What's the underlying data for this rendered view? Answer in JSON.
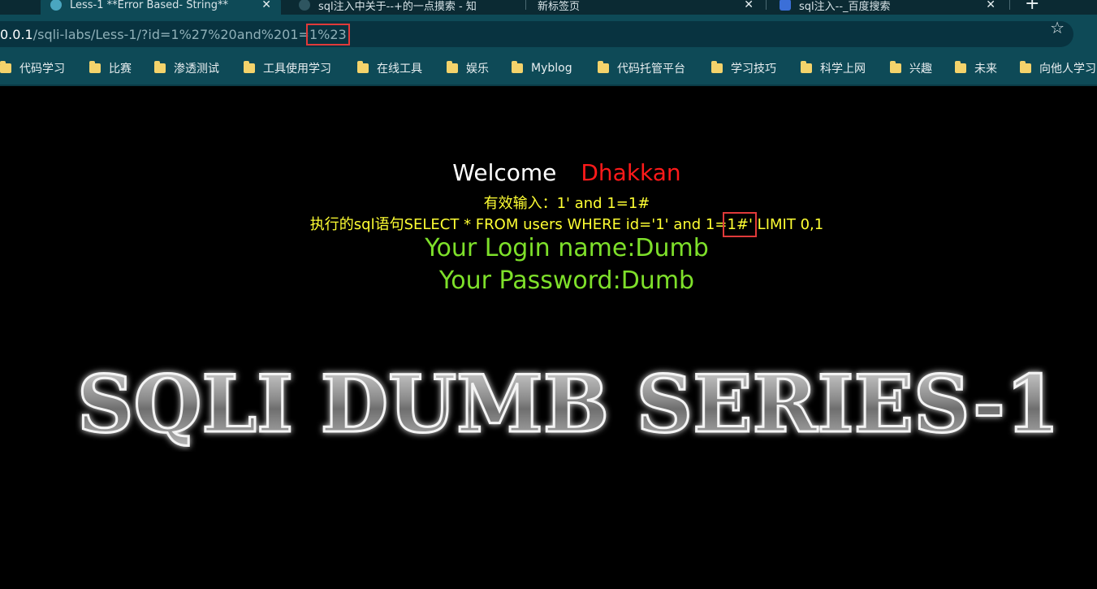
{
  "browser": {
    "tabs": [
      {
        "title": "Less-1 **Error Based- String**",
        "active": true
      },
      {
        "title": "sql注入中关于--+的一点摸索 - 知",
        "active": false
      },
      {
        "title": "新标签页",
        "active": false
      },
      {
        "title": "sql注入--_百度搜索",
        "active": false
      }
    ],
    "close_glyph": "✕",
    "newtab_glyph": "+",
    "url": {
      "host_part": "0.0.1",
      "path_part": "/sqli-labs/Less-1/?id=1%27%20and%201=",
      "highlighted_part": "1%23"
    },
    "star_glyph": "☆",
    "bookmarks": [
      "代码学习",
      "比赛",
      "渗透测试",
      "工具使用学习",
      "在线工具",
      "娱乐",
      "Myblog",
      "代码托管平台",
      "学习技巧",
      "科学上网",
      "兴趣",
      "未来",
      "向他人学习"
    ]
  },
  "page": {
    "welcome_label": "Welcome",
    "welcome_name": "Dhakkan",
    "valid_input": "有效输入：1' and 1=1#",
    "sql_prefix": "执行的sql语句SELECT * FROM users WHERE id='1' and 1=",
    "sql_highlight": "1#'",
    "sql_suffix": " LIMIT 0,1",
    "login_name": "Your Login name:Dumb",
    "password": "Your Password:Dumb",
    "banner_text": "SQLI DUMB SERIES-1"
  },
  "colors": {
    "tab_bar": "#0b2a33",
    "toolbar": "#0e4a57",
    "highlight_box": "#e03a3a",
    "welcome_name": "#ff1a1a",
    "sql_text": "#ffff33",
    "login_text": "#7ee02a"
  }
}
